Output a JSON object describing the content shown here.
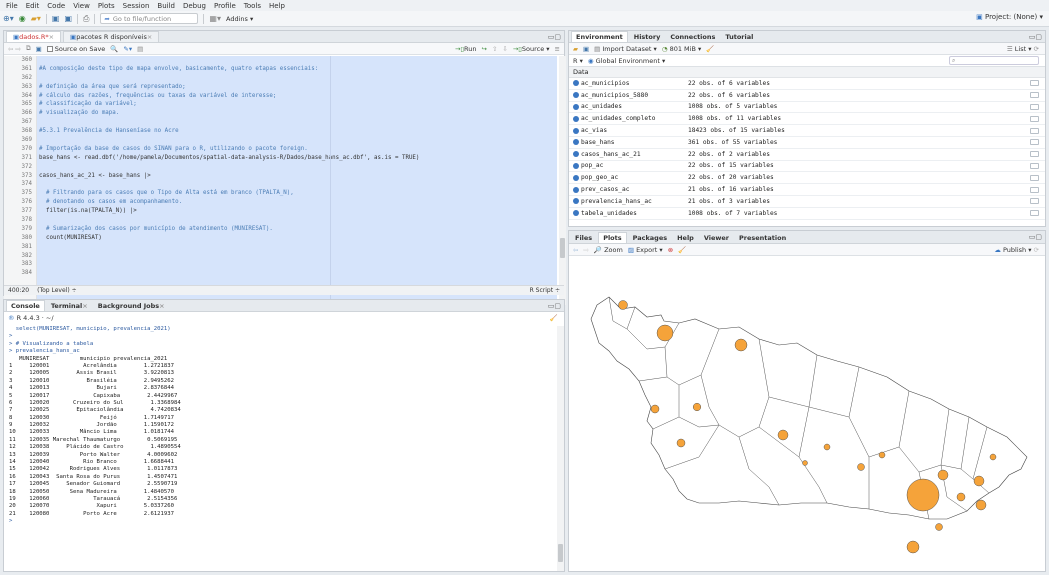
{
  "menu": [
    "File",
    "Edit",
    "Code",
    "View",
    "Plots",
    "Session",
    "Build",
    "Debug",
    "Profile",
    "Tools",
    "Help"
  ],
  "toolbar": {
    "goto_placeholder": "Go to file/function",
    "addins": "Addins",
    "project": "Project: (None)"
  },
  "editor": {
    "tabs": [
      {
        "label": "dados.R*",
        "active": true
      },
      {
        "label": "pacotes R disponíveis",
        "active": false
      }
    ],
    "source_on_save": "Source on Save",
    "run_label": "Run",
    "source_label": "Source",
    "lines": [
      {
        "n": "360",
        "t": ""
      },
      {
        "n": "361",
        "t": "#A composição deste tipo de mapa envolve, basicamente, quatro etapas essenciais:",
        "c": true
      },
      {
        "n": "362",
        "t": ""
      },
      {
        "n": "363",
        "t": "# definição da área que será representado;",
        "c": true
      },
      {
        "n": "364",
        "t": "# cálculo das razões, frequências ou taxas da variável de interesse;",
        "c": true
      },
      {
        "n": "365",
        "t": "# classificação da variável;",
        "c": true
      },
      {
        "n": "366",
        "t": "# visualização do mapa.",
        "c": true
      },
      {
        "n": "367",
        "t": ""
      },
      {
        "n": "368",
        "t": "#5.3.1 Prevalência de Hanseníase no Acre",
        "c": true
      },
      {
        "n": "369",
        "t": ""
      },
      {
        "n": "370",
        "t": "# Importação da base de casos do SINAN para o R, utilizando o pacote foreign.",
        "c": true
      },
      {
        "n": "371",
        "t": "base_hans <- read.dbf('/home/pamela/Documentos/spatial-data-analysis-R/Dados/base_hans_ac.dbf', as.is = TRUE)"
      },
      {
        "n": "372",
        "t": ""
      },
      {
        "n": "373",
        "t": "casos_hans_ac_21 <- base_hans |>"
      },
      {
        "n": "374",
        "t": ""
      },
      {
        "n": "375",
        "t": "  # Filtrando para os casos que o Tipo de Alta está em branco (TPALTA_N),",
        "c": true
      },
      {
        "n": "376",
        "t": "  # denotando os casos em acompanhamento.",
        "c": true
      },
      {
        "n": "377",
        "t": "  filter(is.na(TPALTA_N)) |>"
      },
      {
        "n": "378",
        "t": ""
      },
      {
        "n": "379",
        "t": "  # Sumarização dos casos por município de atendimento (MUNIRESAT).",
        "c": true
      },
      {
        "n": "380",
        "t": "  count(MUNIRESAT)"
      },
      {
        "n": "381",
        "t": ""
      },
      {
        "n": "382",
        "t": ""
      },
      {
        "n": "383",
        "t": ""
      },
      {
        "n": "384",
        "t": ""
      }
    ],
    "status_pos": "400:20",
    "status_scope": "(Top Level) ÷",
    "status_type": "R Script ÷"
  },
  "console": {
    "tabs": [
      {
        "label": "Console",
        "active": true
      },
      {
        "label": "Terminal",
        "active": false
      },
      {
        "label": "Background Jobs",
        "active": false
      }
    ],
    "version": "R 4.4.3 · ~/",
    "lines": [
      "  select(MUNIRESAT, municipio, prevalencia_2021)",
      ">",
      "> # Visualizando a tabela",
      "> prevalencia_hans_ac",
      "   MUNIRESAT         municipio prevalencia_2021",
      "1     120001          Acrelândia        1.2721837",
      "2     120005        Assis Brasil        3.9220813",
      "3     120010           Brasiléia        2.9495262",
      "4     120013              Bujari        2.8376844",
      "5     120017             Capixaba        2.4429967",
      "6     120020       Cruzeiro do Sul        1.3368984",
      "7     120025        Epitaciolândia        4.7420834",
      "8     120030               Feijó        1.7149717",
      "9     120032              Jordão        1.1590172",
      "10    120033         Mâncio Lima        1.0181744",
      "11    120035 Marechal Thaumaturgo        0.5069195",
      "12    120038     Plácido de Castro        1.4890554",
      "13    120039         Porto Walter        4.0009602",
      "14    120040          Rio Branco        1.6688441",
      "15    120042      Rodrigues Alves        1.0117873",
      "16    120043  Santa Rosa do Purus        1.4507471",
      "17    120045     Senador Guiomard        2.5590719",
      "18    120050      Sena Madureira        1.4840570",
      "19    120060             Tarauacá        2.5154356",
      "20    120070              Xapuri        5.0337260",
      "21    120080          Porto Acre        2.6121937",
      ">"
    ]
  },
  "environment": {
    "tabs": [
      {
        "label": "Environment",
        "active": true
      },
      {
        "label": "History",
        "active": false
      },
      {
        "label": "Connections",
        "active": false
      },
      {
        "label": "Tutorial",
        "active": false
      }
    ],
    "import_label": "Import Dataset",
    "memory": "801 MiB",
    "list_label": "List",
    "lang": "R",
    "scope": "Global Environment",
    "section": "Data",
    "rows": [
      {
        "name": "ac_municipios",
        "value": "22 obs. of 6 variables"
      },
      {
        "name": "ac_municipios_5880",
        "value": "22 obs. of 6 variables"
      },
      {
        "name": "ac_unidades",
        "value": "1008 obs. of 5 variables"
      },
      {
        "name": "ac_unidades_completo",
        "value": "1008 obs. of 11 variables"
      },
      {
        "name": "ac_vias",
        "value": "18423 obs. of 15 variables"
      },
      {
        "name": "base_hans",
        "value": "361 obs. of 55 variables"
      },
      {
        "name": "casos_hans_ac_21",
        "value": "22 obs. of 2 variables"
      },
      {
        "name": "pop_ac",
        "value": "22 obs. of 15 variables"
      },
      {
        "name": "pop_geo_ac",
        "value": "22 obs. of 20 variables"
      },
      {
        "name": "prev_casos_ac",
        "value": "21 obs. of 16 variables"
      },
      {
        "name": "prevalencia_hans_ac",
        "value": "21 obs. of 3 variables"
      },
      {
        "name": "tabela_unidades",
        "value": "1008 obs. of 7 variables"
      }
    ]
  },
  "plots": {
    "tabs": [
      {
        "label": "Files",
        "active": false
      },
      {
        "label": "Plots",
        "active": true
      },
      {
        "label": "Packages",
        "active": false
      },
      {
        "label": "Help",
        "active": false
      },
      {
        "label": "Viewer",
        "active": false
      },
      {
        "label": "Presentation",
        "active": false
      }
    ],
    "zoom_label": "Zoom",
    "export_label": "Export",
    "publish_label": "Publish",
    "bubble_color": "#f5a33a"
  }
}
